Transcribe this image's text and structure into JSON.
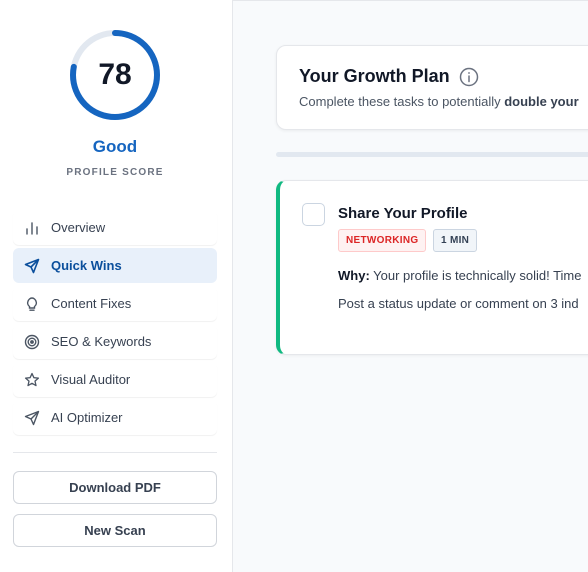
{
  "score": {
    "value": "78",
    "fraction": 0.78,
    "rating": "Good",
    "caption": "PROFILE SCORE",
    "ring_color": "#1565c0",
    "track_color": "#e2e8f0"
  },
  "nav": {
    "items": [
      {
        "label": "Overview",
        "icon": "bar-chart-icon",
        "active": false
      },
      {
        "label": "Quick Wins",
        "icon": "send-icon",
        "active": true
      },
      {
        "label": "Content Fixes",
        "icon": "lightbulb-icon",
        "active": false
      },
      {
        "label": "SEO & Keywords",
        "icon": "target-icon",
        "active": false
      },
      {
        "label": "Visual Auditor",
        "icon": "star-icon",
        "active": false
      },
      {
        "label": "AI Optimizer",
        "icon": "send-icon",
        "active": false
      }
    ]
  },
  "actions": {
    "download_label": "Download PDF",
    "new_scan_label": "New Scan"
  },
  "plan": {
    "title": "Your Growth Plan",
    "subtitle_prefix": "Complete these tasks to potentially ",
    "subtitle_bold": "double your"
  },
  "task": {
    "title": "Share Your Profile",
    "category": "NETWORKING",
    "duration": "1 MIN",
    "why_label": "Why:",
    "why_text": " Your profile is technically solid! Time",
    "action_text": "Post a status update or comment on 3 ind",
    "accent_color": "#10b981"
  }
}
